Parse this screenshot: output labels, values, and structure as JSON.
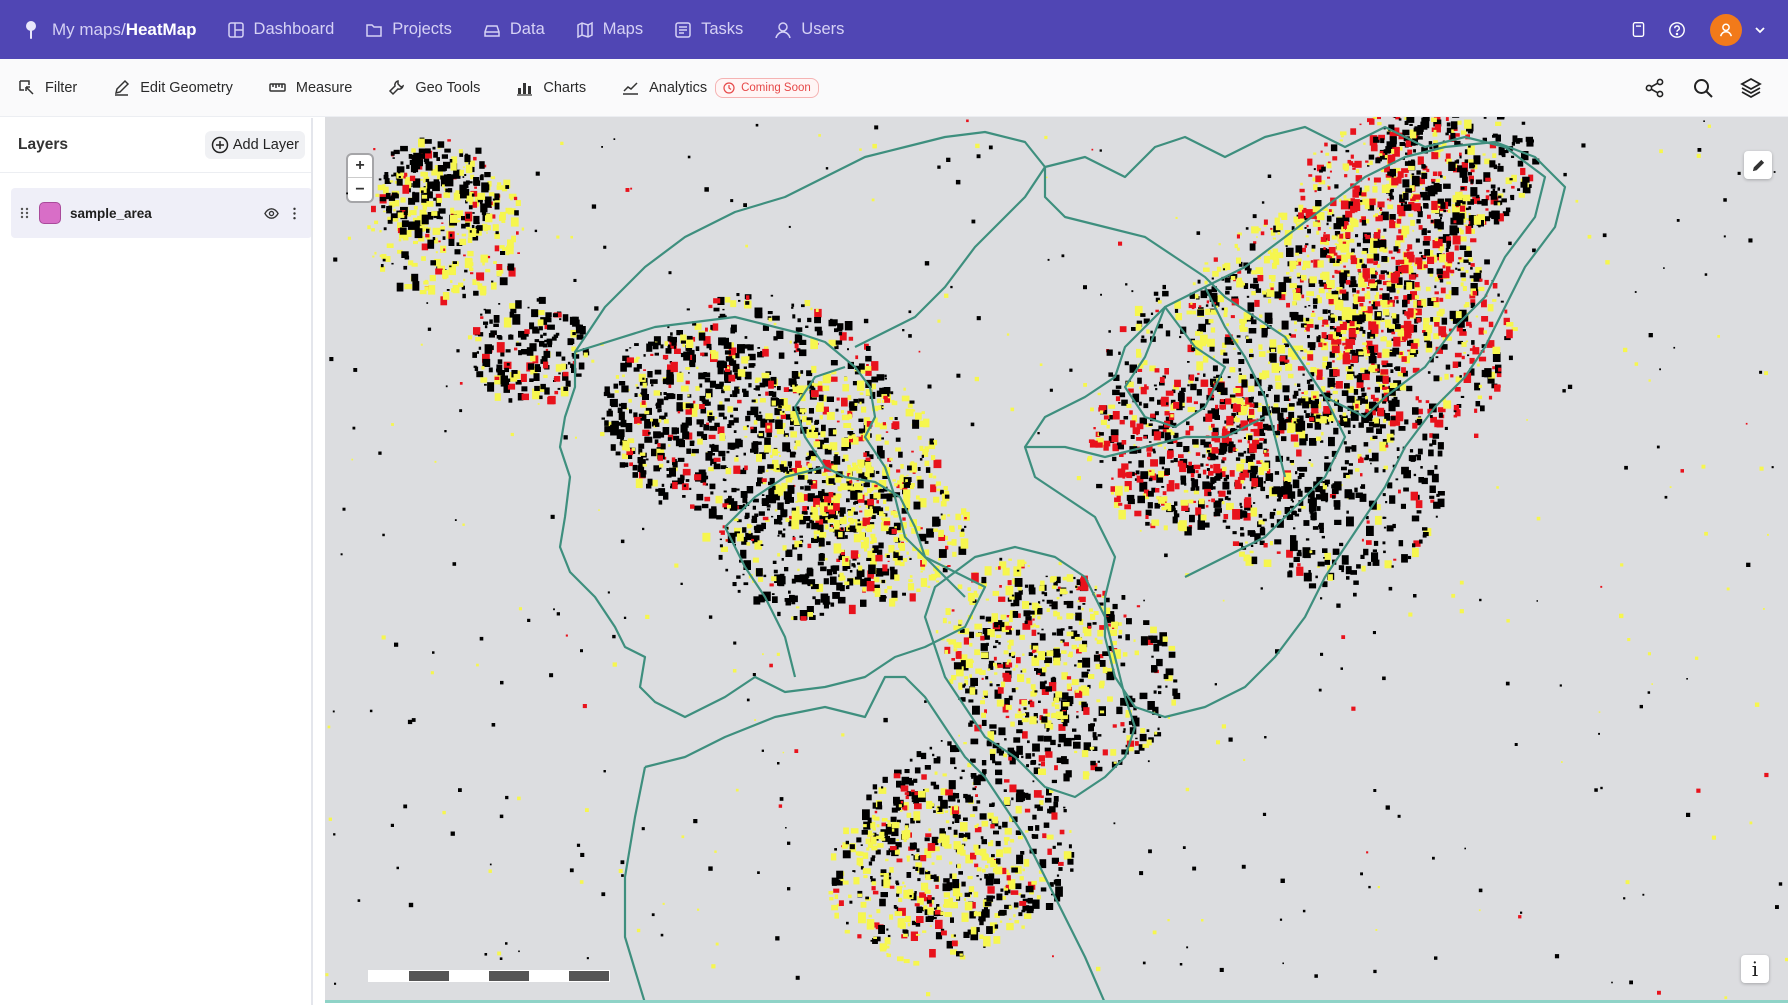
{
  "header": {
    "breadcrumb_path": "My maps/",
    "breadcrumb_current": "HeatMap",
    "nav": [
      {
        "label": "Dashboard",
        "icon": "dashboard-icon"
      },
      {
        "label": "Projects",
        "icon": "folder-icon"
      },
      {
        "label": "Data",
        "icon": "database-icon"
      },
      {
        "label": "Maps",
        "icon": "map-icon"
      },
      {
        "label": "Tasks",
        "icon": "tasks-icon"
      },
      {
        "label": "Users",
        "icon": "user-icon"
      }
    ],
    "right_icons": [
      "docs-icon",
      "help-icon",
      "avatar-user-icon",
      "chevron-down-icon"
    ]
  },
  "toolbar": {
    "tools": [
      {
        "label": "Filter",
        "icon": "filter-icon"
      },
      {
        "label": "Edit Geometry",
        "icon": "pencil-icon"
      },
      {
        "label": "Measure",
        "icon": "ruler-icon"
      },
      {
        "label": "Geo Tools",
        "icon": "wrench-icon"
      },
      {
        "label": "Charts",
        "icon": "bar-chart-icon"
      },
      {
        "label": "Analytics",
        "icon": "trend-line-icon"
      }
    ],
    "coming_soon": "Coming Soon",
    "right_icons": [
      "share-icon",
      "search-icon",
      "layers-icon"
    ]
  },
  "sidebar": {
    "title": "Layers",
    "add_layer": "Add Layer",
    "layers": [
      {
        "name": "sample_area",
        "color": "#d86ec7",
        "visible": true
      }
    ]
  },
  "map": {
    "zoom_in": "+",
    "zoom_out": "−",
    "info": "i",
    "colors": {
      "background": "#dcdde0",
      "boundary": "#3e8f7e",
      "high": "#e8121c",
      "medium": "#f6f64e",
      "dense": "#000000"
    }
  },
  "colors": {
    "header_bg": "#5046b4",
    "accent_orange": "#f27a1a",
    "badge_red": "#e64848"
  }
}
